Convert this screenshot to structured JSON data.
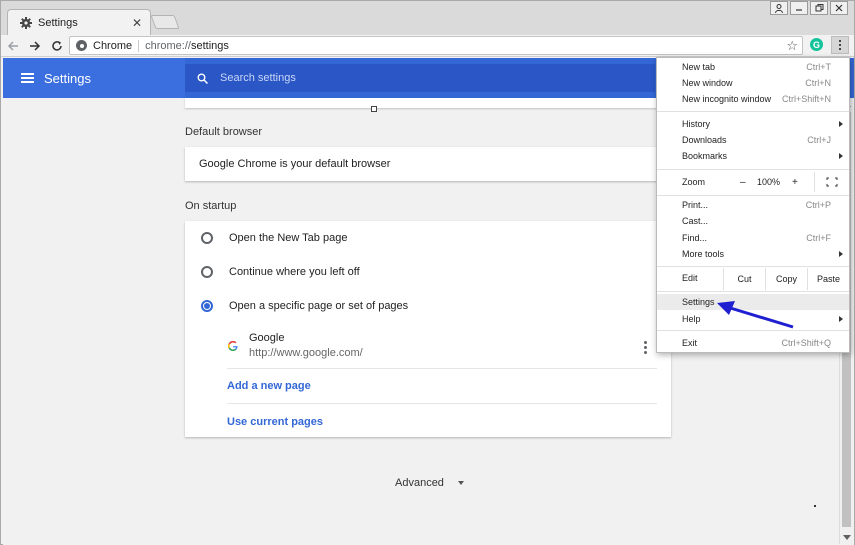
{
  "window": {
    "tab_title": "Settings",
    "tab_close": "✕"
  },
  "toolbar": {
    "site_chip": "Chrome",
    "url_scheme": "chrome://",
    "url_path": "settings",
    "ext_badge": "G"
  },
  "header": {
    "title": "Settings",
    "search_placeholder": "Search settings"
  },
  "sections": {
    "default_browser": {
      "label": "Default browser",
      "text": "Google Chrome is your default browser"
    },
    "on_startup": {
      "label": "On startup",
      "options": [
        {
          "label": "Open the New Tab page",
          "checked": false
        },
        {
          "label": "Continue where you left off",
          "checked": false
        },
        {
          "label": "Open a specific page or set of pages",
          "checked": true
        }
      ],
      "page": {
        "name": "Google",
        "url": "http://www.google.com/"
      },
      "add_page": "Add a new page",
      "use_current": "Use current pages"
    },
    "advanced": "Advanced"
  },
  "menu": {
    "new_tab": {
      "label": "New tab",
      "shortcut": "Ctrl+T"
    },
    "new_window": {
      "label": "New window",
      "shortcut": "Ctrl+N"
    },
    "new_incognito": {
      "label": "New incognito window",
      "shortcut": "Ctrl+Shift+N"
    },
    "history": {
      "label": "History"
    },
    "downloads": {
      "label": "Downloads",
      "shortcut": "Ctrl+J"
    },
    "bookmarks": {
      "label": "Bookmarks"
    },
    "zoom": {
      "label": "Zoom",
      "minus": "–",
      "value": "100%",
      "plus": "+"
    },
    "print": {
      "label": "Print...",
      "shortcut": "Ctrl+P"
    },
    "cast": {
      "label": "Cast..."
    },
    "find": {
      "label": "Find...",
      "shortcut": "Ctrl+F"
    },
    "more_tools": {
      "label": "More tools"
    },
    "edit": {
      "label": "Edit",
      "cut": "Cut",
      "copy": "Copy",
      "paste": "Paste"
    },
    "settings": {
      "label": "Settings"
    },
    "help": {
      "label": "Help"
    },
    "exit": {
      "label": "Exit",
      "shortcut": "Ctrl+Shift+Q"
    }
  },
  "colors": {
    "header_blue": "#3367d6",
    "link_blue": "#3367d6",
    "annotation_arrow": "#1f1fd1"
  }
}
